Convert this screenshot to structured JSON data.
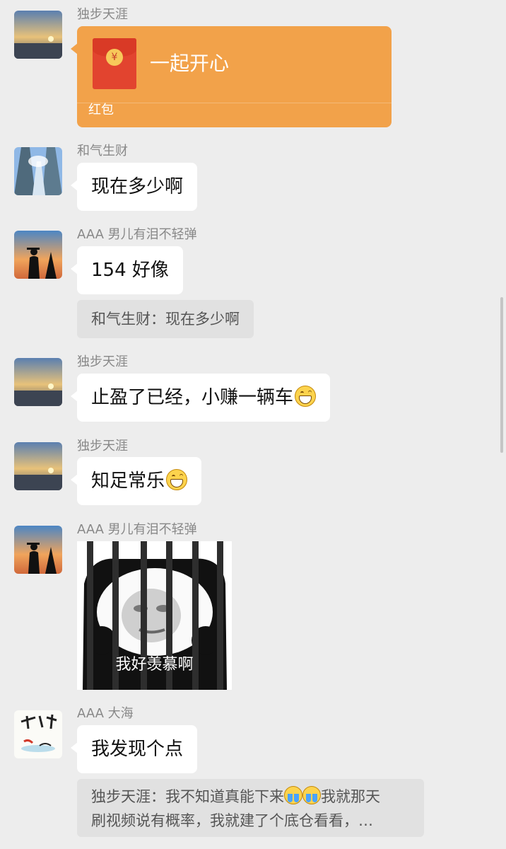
{
  "messages": [
    {
      "sender": "独步天涯",
      "type": "red_packet",
      "title": "一起开心",
      "label": "红包"
    },
    {
      "sender": "和气生财",
      "type": "text",
      "text": "现在多少啊"
    },
    {
      "sender": "AAA 男儿有泪不轻弹",
      "type": "text",
      "text": "154 好像",
      "quote": "和气生财：现在多少啊"
    },
    {
      "sender": "独步天涯",
      "type": "text",
      "text": "止盈了已经，小赚一辆车",
      "emoji": "grinning-face"
    },
    {
      "sender": "独步天涯",
      "type": "text",
      "text": "知足常乐",
      "emoji": "grinning-face"
    },
    {
      "sender": "AAA 男儿有泪不轻弹",
      "type": "sticker",
      "caption": "我好羡慕啊"
    },
    {
      "sender": "AAA 大海",
      "type": "text",
      "text": "我发现个点",
      "quote_part1": "独步天涯：我不知道真能下来",
      "quote_part2": "我就那天",
      "quote_line2": "刷视频说有概率，我就建了个底仓看看，…"
    }
  ],
  "red_packet_symbol": "¥",
  "colors": {
    "background": "#ededed",
    "bubble": "#ffffff",
    "red_packet": "#f2a24a",
    "quote": "#e1e1e1"
  }
}
